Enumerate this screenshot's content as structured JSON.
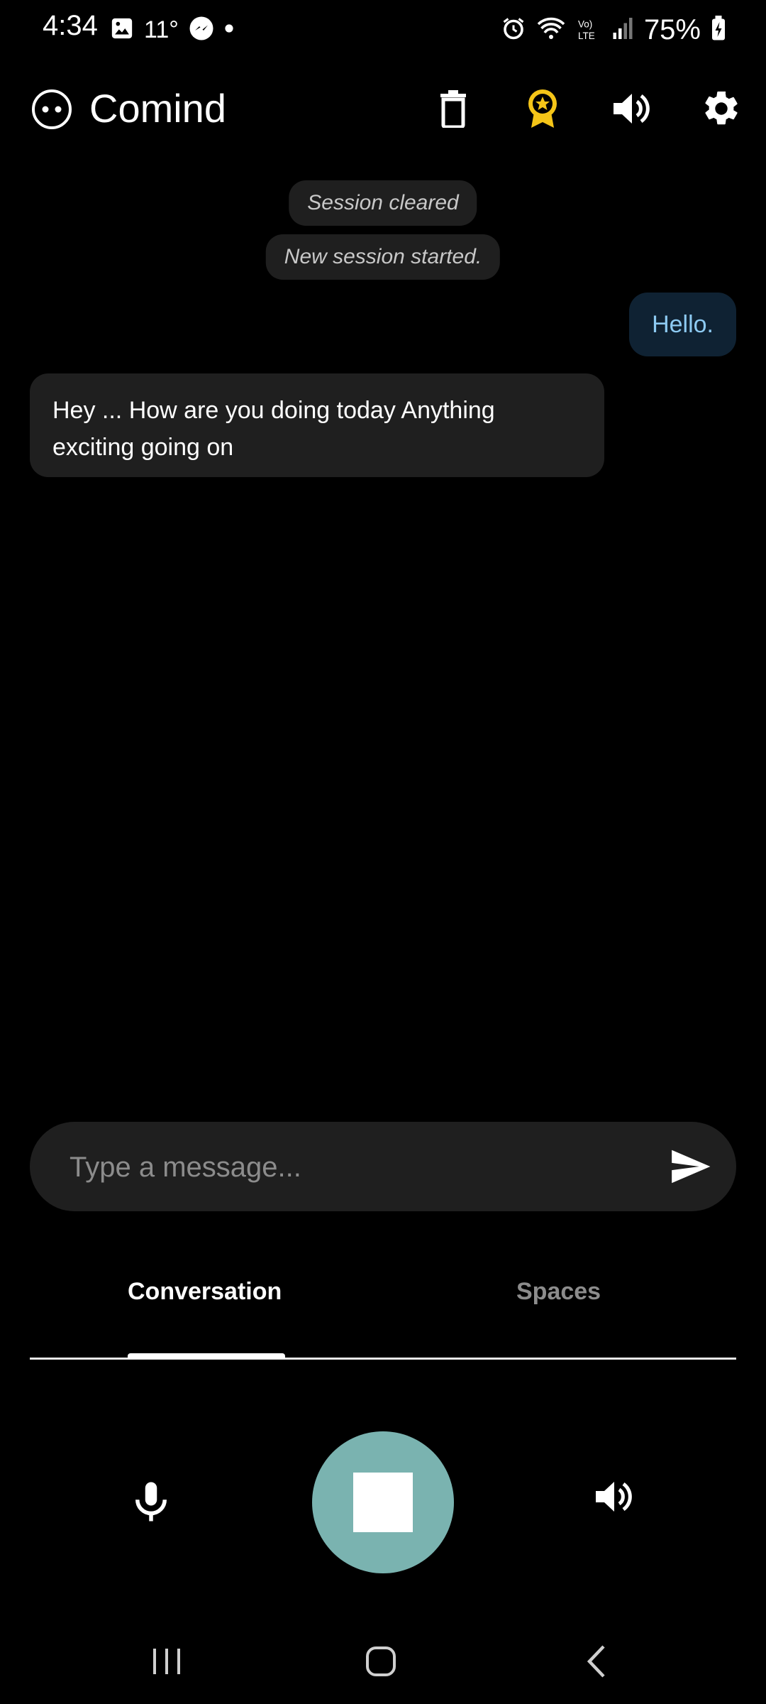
{
  "status_bar": {
    "time": "4:34",
    "temperature": "11°",
    "battery": "75%",
    "icons": [
      "gallery-icon",
      "messenger-icon",
      "dot-icon",
      "alarm-icon",
      "wifi-icon",
      "volte-icon",
      "signal-icon",
      "battery-icon"
    ]
  },
  "app_bar": {
    "title": "Comind",
    "logo": "face-icon",
    "actions": [
      "trash-icon",
      "award-icon",
      "volume-icon",
      "settings-icon"
    ],
    "award_color": "#f5c518"
  },
  "chat": {
    "system_messages": [
      "Session cleared",
      "New session started."
    ],
    "user_message": "Hello.",
    "bot_message": "Hey ... How are you doing today Anything exciting going on"
  },
  "input": {
    "placeholder": "Type a message...",
    "value": ""
  },
  "tabs": {
    "items": [
      "Conversation",
      "Spaces"
    ],
    "active": "Conversation"
  },
  "controls": {
    "accent": "#7ab3b0"
  }
}
